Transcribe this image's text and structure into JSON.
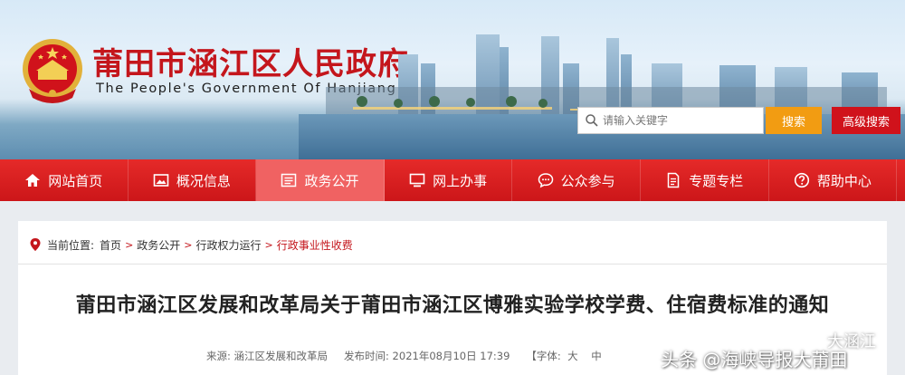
{
  "header": {
    "title": "莆田市涵江区人民政府",
    "subtitle": "The People's Government Of Hanjiang",
    "search": {
      "placeholder": "请输入关键字",
      "button_label": "搜索",
      "advanced_label": "高级搜索"
    }
  },
  "nav": {
    "items": [
      {
        "label": "网站首页",
        "icon": "home-icon"
      },
      {
        "label": "概况信息",
        "icon": "picture-icon"
      },
      {
        "label": "政务公开",
        "icon": "list-icon",
        "active": true
      },
      {
        "label": "网上办事",
        "icon": "monitor-icon"
      },
      {
        "label": "公众参与",
        "icon": "chat-icon"
      },
      {
        "label": "专题专栏",
        "icon": "document-icon"
      },
      {
        "label": "帮助中心",
        "icon": "help-icon"
      }
    ]
  },
  "breadcrumb": {
    "prefix": "当前位置:",
    "items": [
      "首页",
      "政务公开",
      "行政权力运行",
      "行政事业性收费"
    ]
  },
  "article": {
    "title": "莆田市涵江区发展和改革局关于莆田市涵江区博雅实验学校学费、住宿费标准的通知",
    "source": "来源: 涵江区发展和改革局",
    "published": "发布时间: 2021年08月10日 17:39",
    "font_size_label": "【字体:  大    中"
  },
  "watermark": {
    "top": "大涵江",
    "bottom": "头条 @海峡导报大莆田"
  },
  "colors": {
    "brand_red": "#c4161c",
    "nav_active": "#f06262",
    "search_orange": "#f29c12"
  }
}
